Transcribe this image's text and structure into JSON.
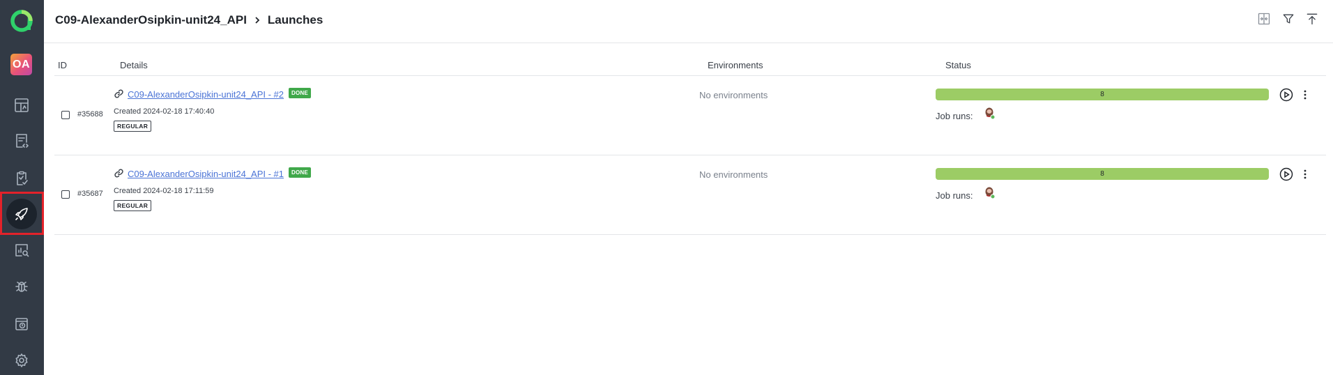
{
  "sidebar": {
    "avatar_initials": "OA",
    "items": [
      {
        "name": "dashboard",
        "icon": "dashboard-icon"
      },
      {
        "name": "test-cases",
        "icon": "test-cases-icon"
      },
      {
        "name": "test-plans",
        "icon": "test-plans-icon"
      },
      {
        "name": "launches",
        "icon": "rocket-icon",
        "active": true
      },
      {
        "name": "analytics",
        "icon": "analytics-icon"
      },
      {
        "name": "defects",
        "icon": "bug-icon"
      },
      {
        "name": "jobs",
        "icon": "jobs-icon"
      },
      {
        "name": "settings",
        "icon": "gear-icon"
      }
    ],
    "active_highlight_color": "#e3222a"
  },
  "header": {
    "project": "C09-AlexanderOsipkin-unit24_API",
    "page": "Launches",
    "actions": [
      "compare-icon",
      "filter-icon",
      "upload-icon"
    ]
  },
  "table": {
    "columns": {
      "id": "ID",
      "details": "Details",
      "environments": "Environments",
      "status": "Status"
    },
    "rows": [
      {
        "id": "#35688",
        "name": "C09-AlexanderOsipkin-unit24_API - #2",
        "state": "DONE",
        "created": "Created 2024-02-18 17:40:40",
        "type": "REGULAR",
        "environments": "No environments",
        "passed_count": "8",
        "passed_fraction": 1.0,
        "job_runs_label": "Job runs:"
      },
      {
        "id": "#35687",
        "name": "C09-AlexanderOsipkin-unit24_API - #1",
        "state": "DONE",
        "created": "Created 2024-02-18 17:11:59",
        "type": "REGULAR",
        "environments": "No environments",
        "passed_count": "8",
        "passed_fraction": 1.0,
        "job_runs_label": "Job runs:"
      }
    ]
  },
  "colors": {
    "sidebar_bg": "#323a45",
    "link": "#4a73d6",
    "done_badge": "#40a84a",
    "passed_bar": "#9ccc65"
  }
}
